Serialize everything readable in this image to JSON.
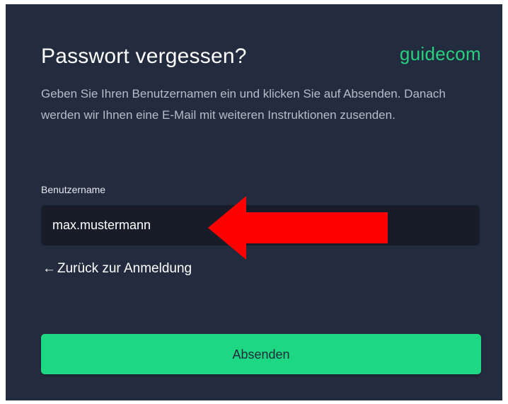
{
  "dialog": {
    "title": "Passwort vergessen?",
    "logo": "guidecom",
    "description": "Geben Sie Ihren Benutzernamen ein und klicken Sie auf Absenden. Danach werden wir Ihnen eine E-Mail mit weiteren Instruktionen zusenden."
  },
  "username_field": {
    "label": "Benutzername",
    "value": "max.mustermann"
  },
  "back_link": {
    "icon": "arrow-left-icon",
    "arrow_glyph": "←",
    "label": "Zurück zur Anmeldung"
  },
  "submit_button": {
    "label": "Absenden"
  },
  "annotation": {
    "icon": "red-arrow-icon",
    "color": "#ff0000"
  },
  "colors": {
    "panel_bg": "#232b3e",
    "input_bg": "#181c28",
    "accent": "#1ed783",
    "logo": "#28d07f"
  }
}
